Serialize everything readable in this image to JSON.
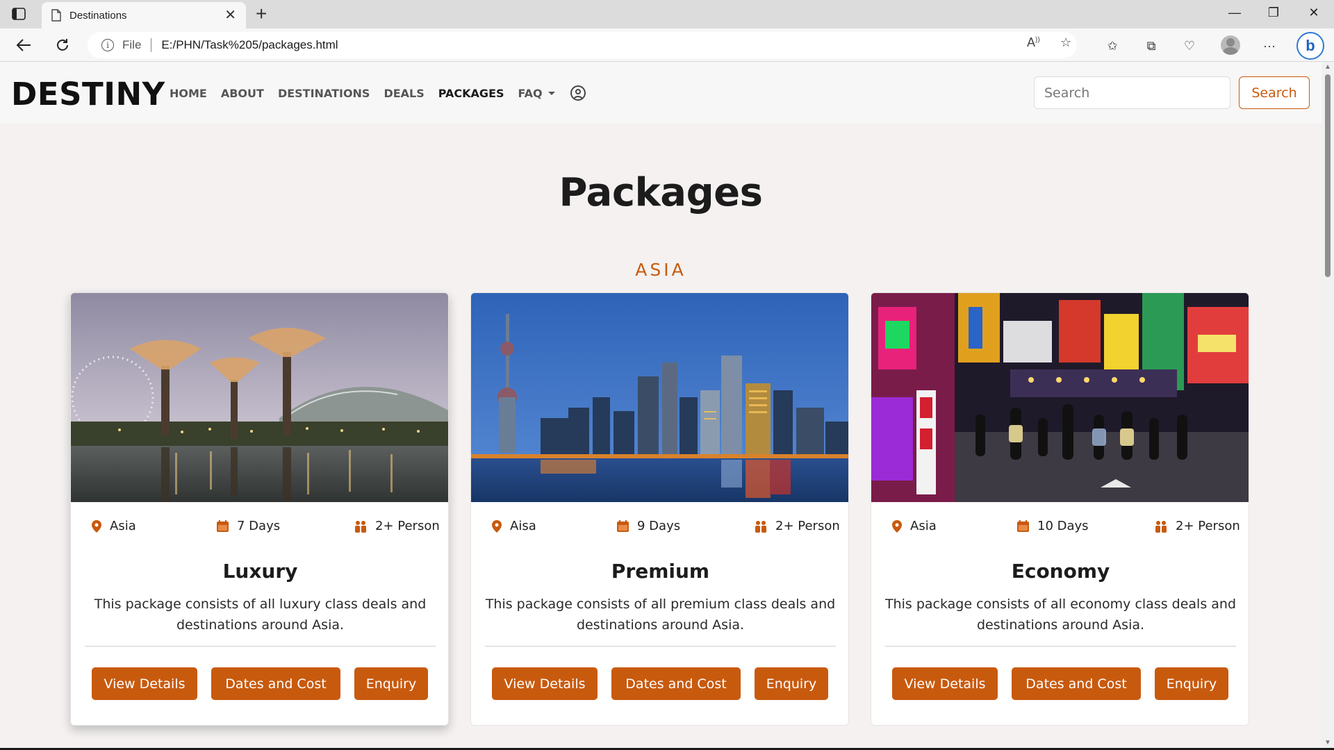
{
  "browser": {
    "tab_title": "Destinations",
    "url_scheme_label": "File",
    "url": "E:/PHN/Task%205/packages.html"
  },
  "site": {
    "logo": "DESTINY",
    "nav": [
      "HOME",
      "ABOUT",
      "DESTINATIONS",
      "DEALS",
      "PACKAGES",
      "FAQ"
    ],
    "active_nav": "PACKAGES",
    "search_placeholder": "Search",
    "search_button": "Search"
  },
  "page": {
    "title": "Packages",
    "section": "ASIA"
  },
  "cards": [
    {
      "location": "Asia",
      "duration": "7 Days",
      "people": "2+ Person",
      "title": "Luxury",
      "description": "This package consists of all luxury class deals and destinations around Asia.",
      "buttons": [
        "View Details",
        "Dates and Cost",
        "Enquiry"
      ]
    },
    {
      "location": "Aisa",
      "duration": "9 Days",
      "people": "2+ Person",
      "title": "Premium",
      "description": "This package consists of all premium class deals and destinations around Asia.",
      "buttons": [
        "View Details",
        "Dates and Cost",
        "Enquiry"
      ]
    },
    {
      "location": "Asia",
      "duration": "10 Days",
      "people": "2+ Person",
      "title": "Economy",
      "description": "This package consists of all economy class deals and destinations around Asia.",
      "buttons": [
        "View Details",
        "Dates and Cost",
        "Enquiry"
      ]
    }
  ],
  "colors": {
    "accent": "#c85a0e",
    "page_bg": "#f4f1f0"
  }
}
